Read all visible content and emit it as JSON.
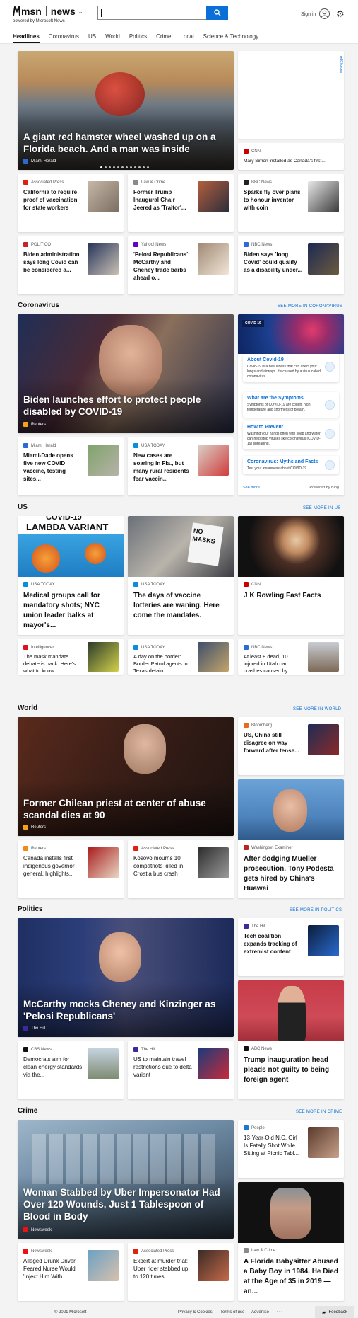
{
  "header": {
    "logo_msn": "msn",
    "logo_news": "news",
    "powered": "powered by Microsoft News",
    "signin": "Sign in",
    "search_placeholder": ""
  },
  "nav": [
    "Headlines",
    "Coronavirus",
    "US",
    "World",
    "Politics",
    "Crime",
    "Local",
    "Science & Technology"
  ],
  "top": {
    "hero": {
      "title": "A giant red hamster wheel washed up on a Florida beach. And a man was inside",
      "source": "Miami Herald"
    },
    "ad_label": "AdChoices",
    "side": {
      "source": "CNN",
      "title": "Mary Simon installed as Canada's first..."
    },
    "cards": [
      {
        "source": "Associated Press",
        "title": "California to require proof of vaccination for state workers"
      },
      {
        "source": "Law & Crime",
        "title": "Former Trump Inaugural Chair Jeered as 'Traitor'..."
      },
      {
        "source": "BBC News",
        "title": "Sparks fly over plans to honour inventor with coin"
      },
      {
        "source": "POLITICO",
        "title": "Biden administration says long Covid can be considered a..."
      },
      {
        "source": "Yahoo! News",
        "title": "'Pelosi Republicans': McCarthy and Cheney trade barbs ahead o..."
      },
      {
        "source": "NBC News",
        "title": "Biden says 'long Covid' could qualify as a disability under..."
      }
    ]
  },
  "coronavirus": {
    "heading": "Coronavirus",
    "more": "SEE MORE IN CORONAVIRUS",
    "hero": {
      "title": "Biden launches effort to protect people disabled by COVID-19",
      "source": "Reuters"
    },
    "cards": [
      {
        "source": "Miami Herald",
        "title": "Miami-Dade opens five new COVID vaccine, testing sites..."
      },
      {
        "source": "USA TODAY",
        "title": "New cases are soaring in Fla., but many rural residents fear vaccin..."
      }
    ],
    "panel": {
      "pill": "COVID 19",
      "items": [
        {
          "title": "About Covid-19",
          "desc": "Covid-19 is a new illness that can affect your lungs and airways. It's caused by a virus called coronavirus."
        },
        {
          "title": "What are the Symptoms",
          "desc": "Symptoms of COVID-19 are cough, high temperature and shortness of breath."
        },
        {
          "title": "How to Prevent",
          "desc": "Washing your hands often with soap and water can help stop viruses like coronavirus (COVID-19) spreading."
        },
        {
          "title": "Coronavirus: Myths and Facts",
          "desc": "Test your awareness about COVID-19."
        }
      ],
      "see_more": "See more",
      "powered": "Powered by Bing"
    }
  },
  "us": {
    "heading": "US",
    "more": "SEE MORE IN US",
    "big": [
      {
        "source": "USA TODAY",
        "title": "Medical groups call for mandatory shots; NYC union leader balks at mayor's...",
        "img_text": "LAMBDA VARIANT",
        "img_text_top": "COVID-19"
      },
      {
        "source": "USA TODAY",
        "title": "The days of vaccine lotteries are waning. Here come the mandates.",
        "img_text": "NO MASKS"
      },
      {
        "source": "CNN",
        "title": "J K Rowling Fast Facts"
      }
    ],
    "cards": [
      {
        "source": "Intelligencer",
        "title": "The mask mandate debate is back. Here's what to know."
      },
      {
        "source": "USA TODAY",
        "title": "A day on the border: Border Patrol agents in Texas detain..."
      },
      {
        "source": "NBC News",
        "title": "At least 8 dead, 10 injured in Utah car crashes caused by..."
      }
    ]
  },
  "world": {
    "heading": "World",
    "more": "SEE MORE IN WORLD",
    "hero": {
      "title": "Former Chilean priest at center of abuse scandal dies at 90",
      "source": "Reuters"
    },
    "side": {
      "source": "Bloomberg",
      "title": "US, China still disagree on way forward after tense..."
    },
    "big": {
      "source": "Washington Examiner",
      "title": "After dodging Mueller prosecution, Tony Podesta gets hired by China's Huawei"
    },
    "cards": [
      {
        "source": "Reuters",
        "title": "Canada installs first indigenous governor general, highlights..."
      },
      {
        "source": "Associated Press",
        "title": "Kosovo mourns 10 compatriots killed in Croatia bus crash"
      }
    ]
  },
  "politics": {
    "heading": "Politics",
    "more": "SEE MORE IN POLITICS",
    "hero": {
      "title": "McCarthy mocks Cheney and Kinzinger as 'Pelosi Republicans'",
      "source": "The Hill"
    },
    "side": {
      "source": "The Hill",
      "title": "Tech coalition expands tracking of extremist content"
    },
    "big": {
      "source": "ABC News",
      "title": "Trump inauguration head pleads not guilty to being foreign agent"
    },
    "cards": [
      {
        "source": "CBS News",
        "title": "Democrats aim for clean energy standards via the..."
      },
      {
        "source": "The Hill",
        "title": "US to maintain travel restrictions due to delta variant"
      }
    ]
  },
  "crime": {
    "heading": "Crime",
    "more": "SEE MORE IN CRIME",
    "hero": {
      "title": "Woman Stabbed by Uber Impersonator Had Over 120 Wounds, Just 1 Tablespoon of Blood in Body",
      "source": "Newsweek"
    },
    "side": {
      "source": "People",
      "title": "13-Year-Old N.C. Girl Is Fatally Shot While Sitting at Picnic Tabl..."
    },
    "big": {
      "source": "Law & Crime",
      "title": "A Florida Babysitter Abused a Baby Boy in 1984. He Died at the Age of 35 in 2019 — an..."
    },
    "cards": [
      {
        "source": "Newsweek",
        "title": "Alleged Drunk Driver Feared Nurse Would 'Inject Him With..."
      },
      {
        "source": "Associated Press",
        "title": "Expert at murder trial: Uber rider stabbed up to 120 times"
      }
    ]
  },
  "footer": {
    "copyright": "© 2021 Microsoft",
    "privacy": "Privacy & Cookies",
    "terms": "Terms of use",
    "advertise": "Advertise",
    "ellipsis": "• • •",
    "feedback": "Feedback"
  }
}
